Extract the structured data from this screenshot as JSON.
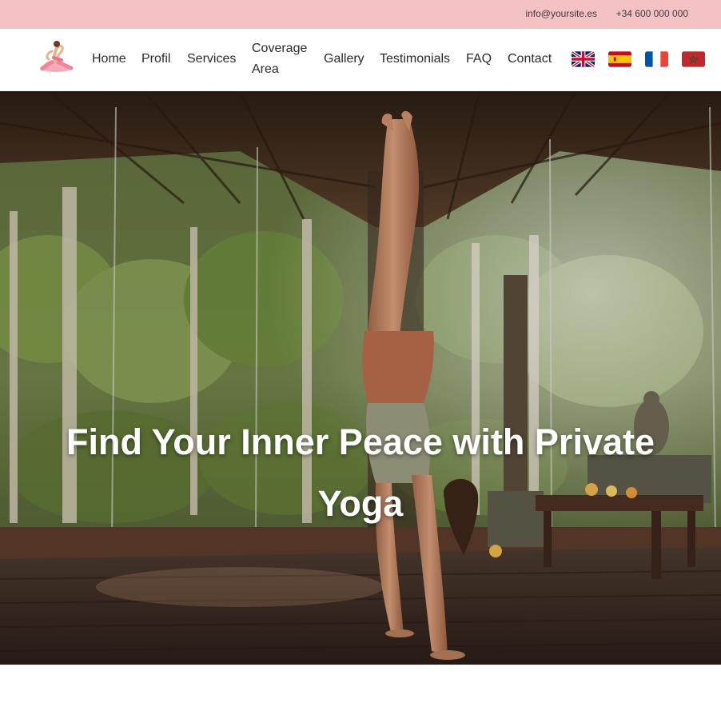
{
  "topbar": {
    "email": "info@yoursite.es",
    "phone": "+34 600 000 000"
  },
  "nav": {
    "logo_icon": "yoga-pose-logo-icon",
    "items": [
      {
        "label": "Home"
      },
      {
        "label": "Profil"
      },
      {
        "label": "Services"
      },
      {
        "label": "Coverage"
      },
      {
        "label": "Area"
      },
      {
        "label": "Gallery"
      },
      {
        "label": "Testimonials"
      },
      {
        "label": "FAQ"
      },
      {
        "label": "Contact"
      }
    ],
    "languages": [
      {
        "icon": "uk-flag-icon"
      },
      {
        "icon": "spain-flag-icon"
      },
      {
        "icon": "france-flag-icon"
      },
      {
        "icon": "morocco-flag-icon"
      }
    ]
  },
  "hero": {
    "title_line1": "Find Your Inner Peace with Private",
    "title_line2": "Yoga",
    "background": "handstand-in-jungle-pavilion-photo"
  },
  "colors": {
    "topbar_bg": "#f4c2c4",
    "nav_text": "#2b2b2b",
    "hero_text": "#ffffff"
  }
}
